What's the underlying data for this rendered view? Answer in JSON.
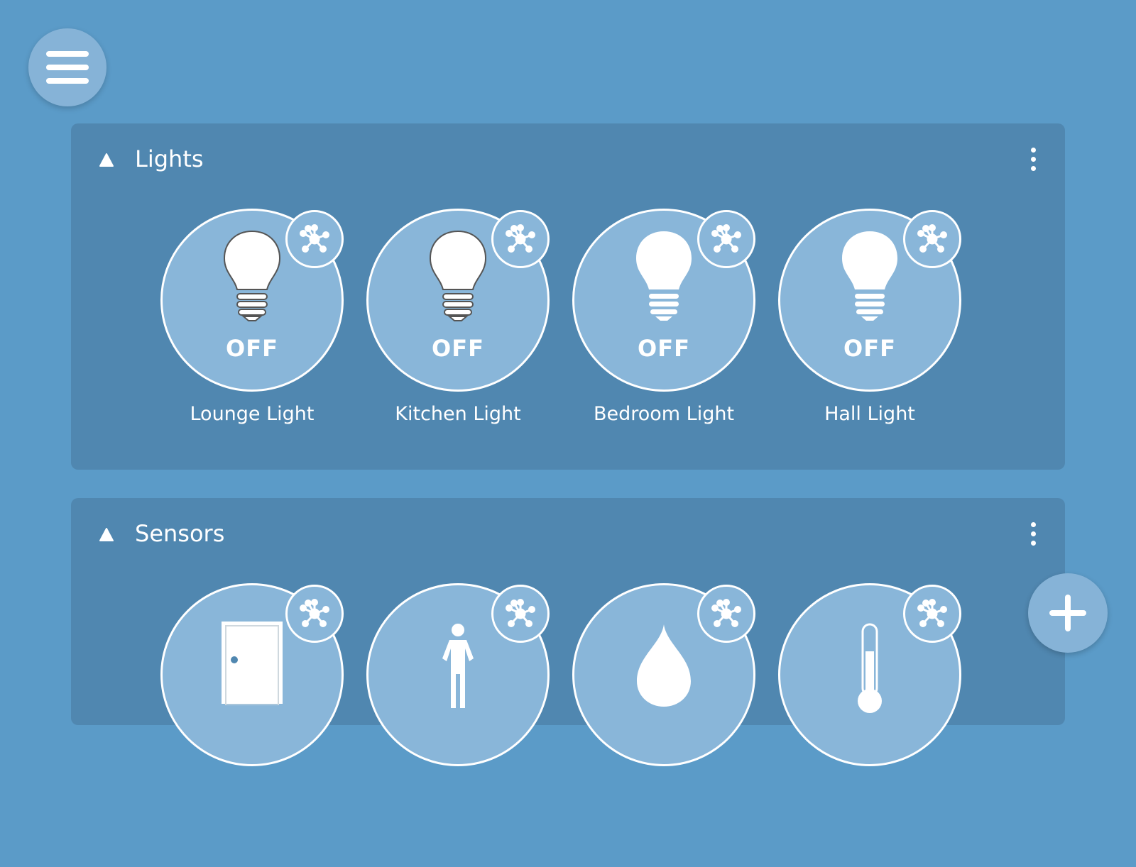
{
  "menu": {
    "icon": "hamburger-menu-icon"
  },
  "fab": {
    "icon": "plus-icon"
  },
  "groups": [
    {
      "title": "Lights",
      "collapse_icon": "triangle-up-icon",
      "more_icon": "more-vert-icon",
      "devices": [
        {
          "label": "Lounge Light",
          "state": "OFF",
          "icon": "lightbulb-outline-icon",
          "badge_icon": "hub-network-icon"
        },
        {
          "label": "Kitchen Light",
          "state": "OFF",
          "icon": "lightbulb-outline-icon",
          "badge_icon": "hub-network-icon"
        },
        {
          "label": "Bedroom Light",
          "state": "OFF",
          "icon": "lightbulb-filled-icon",
          "badge_icon": "hub-network-icon"
        },
        {
          "label": "Hall Light",
          "state": "OFF",
          "icon": "lightbulb-filled-icon",
          "badge_icon": "hub-network-icon"
        }
      ]
    },
    {
      "title": "Sensors",
      "collapse_icon": "triangle-up-icon",
      "more_icon": "more-vert-icon",
      "devices": [
        {
          "icon": "door-icon",
          "badge_icon": "hub-network-icon"
        },
        {
          "icon": "person-motion-icon",
          "badge_icon": "hub-network-icon"
        },
        {
          "icon": "water-drop-icon",
          "badge_icon": "hub-network-icon"
        },
        {
          "icon": "thermometer-icon",
          "badge_icon": "hub-network-icon"
        }
      ]
    }
  ],
  "colors": {
    "background": "#5b9bc8",
    "panel": "#5087b0",
    "tile": "#89b6d9",
    "accent": "#ffffff"
  }
}
